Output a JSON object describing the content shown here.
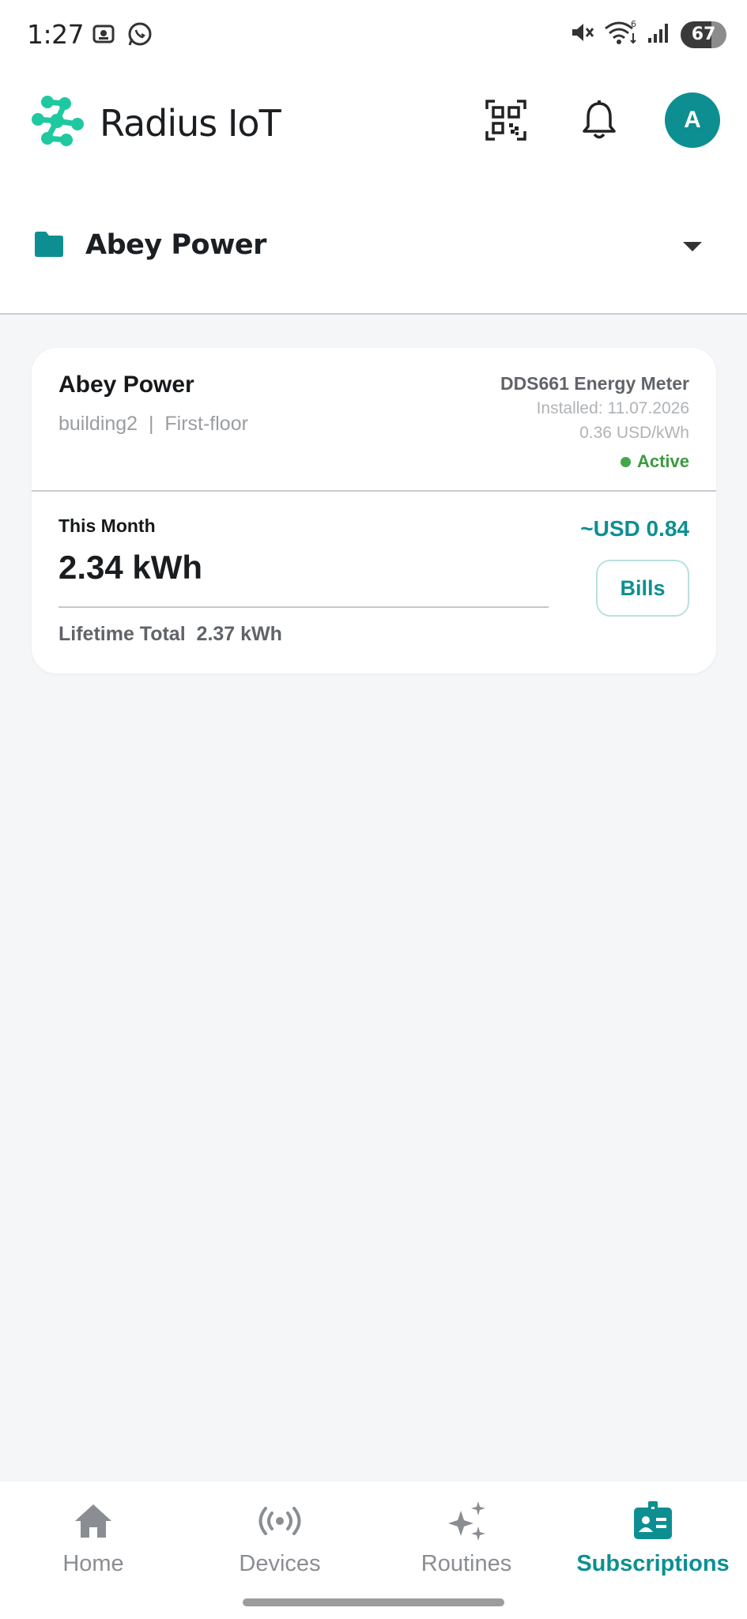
{
  "status_bar": {
    "time": "1:27",
    "battery": "67",
    "icons": [
      "screenshot-icon",
      "whatsapp-icon",
      "mute-icon",
      "wifi-icon",
      "signal-icon",
      "battery-icon"
    ],
    "wifi_badge": "6"
  },
  "header": {
    "brand": "Radius IoT",
    "avatar_initial": "A",
    "icons": [
      "radius-logo-icon",
      "qr-scan-icon",
      "bell-icon"
    ]
  },
  "folder": {
    "name": "Abey Power",
    "icons": [
      "folder-icon",
      "dropdown-caret-icon"
    ]
  },
  "card": {
    "site_name": "Abey Power",
    "location": "building2  |  First-floor",
    "meter_name": "DDS661 Energy Meter",
    "installed": "Installed: 11.07.2026",
    "rate": "0.36 USD/kWh",
    "status": "Active",
    "month_label": "This Month",
    "month_value": "2.34 kWh",
    "cost": "~USD 0.84",
    "bills_label": "Bills",
    "lifetime": "Lifetime Total  2.37 kWh"
  },
  "nav": {
    "items": [
      {
        "label": "Home",
        "icon": "home-icon"
      },
      {
        "label": "Devices",
        "icon": "devices-broadcast-icon"
      },
      {
        "label": "Routines",
        "icon": "sparkle-icon"
      },
      {
        "label": "Subscriptions",
        "icon": "id-badge-icon"
      }
    ],
    "active": "Subscriptions"
  },
  "colors": {
    "accent": "#0d8f91",
    "logo": "#1fc9a0",
    "active_green": "#43a849",
    "background": "#f5f6f8"
  }
}
